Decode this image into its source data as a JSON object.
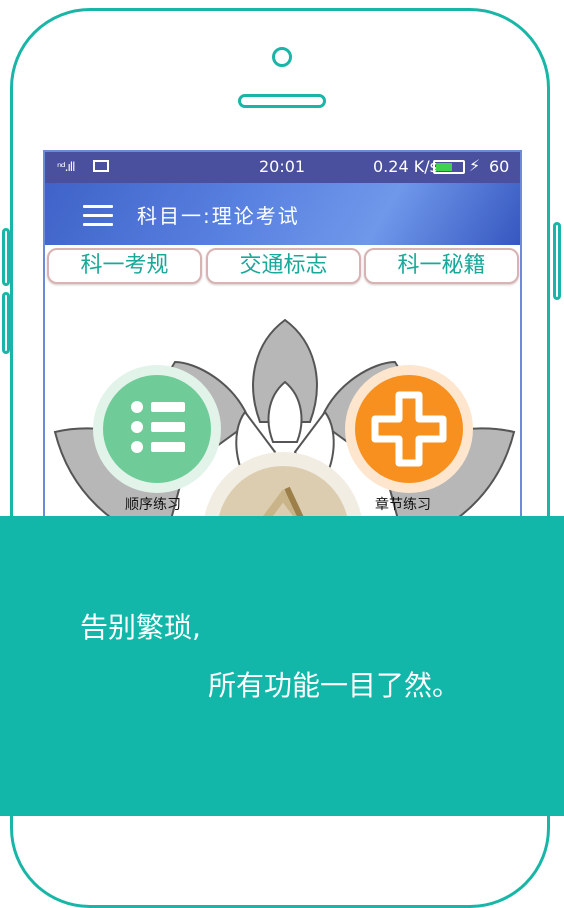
{
  "status_bar": {
    "signal": "ⁿᵈ.ıll",
    "time": "20:01",
    "speed": "0.24 K/s",
    "battery": "60",
    "battery_level": 0.6
  },
  "app_bar": {
    "title": "科目一:理论考试"
  },
  "tabs": [
    {
      "label": "科一考规"
    },
    {
      "label": "交通标志"
    },
    {
      "label": "科一秘籍"
    }
  ],
  "features": {
    "sequential_practice": "顺序练习",
    "chapter_practice": "章节练习"
  },
  "banner": {
    "line1": "告别繁琐,",
    "line2": "所有功能一目了然。"
  },
  "colors": {
    "accent_teal": "#12b7a9",
    "status_bar": "#4a4f9e",
    "green_button": "#6fcc98",
    "orange_button": "#f7901e"
  }
}
